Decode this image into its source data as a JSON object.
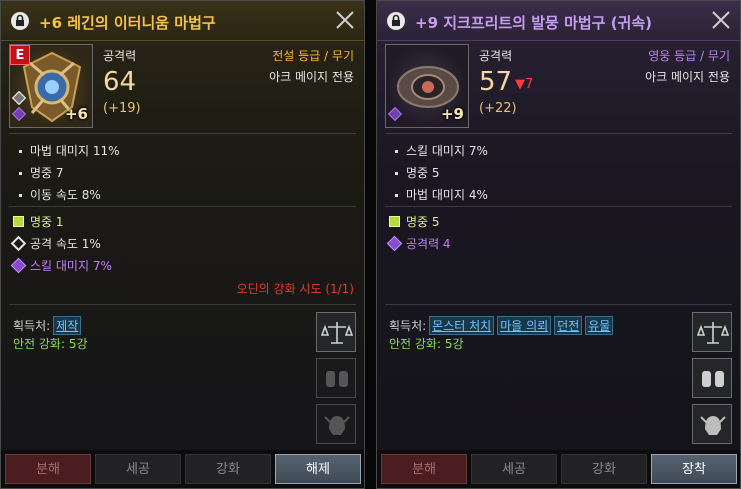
{
  "left": {
    "title": "+6 레긴의 이터니움 마법구",
    "badge": "E",
    "enhance": "+6",
    "attack_label": "공격력",
    "attack_value": "64",
    "attack_bonus": "(+19)",
    "grade": "전설 등급 / 무기",
    "class_only": "아크 메이지 전용",
    "stats": [
      "마법 대미지 11%",
      "명중 7",
      "이동 속도 8%"
    ],
    "subs": [
      {
        "text": "명중 1",
        "color": "#d8f47a"
      },
      {
        "text": "공격 속도 1%",
        "color": "#e4e4e4"
      },
      {
        "text": "스킬 대미지 7%",
        "color": "#c080f5"
      }
    ],
    "odin": "오딘의 강화 시도 (1/1)",
    "source_label": "획득처:",
    "sources": [
      "제작"
    ],
    "safe_enhance": "안전 강화: 5강",
    "buttons": [
      "분해",
      "세공",
      "강화",
      "해제"
    ]
  },
  "right": {
    "title": "+9 지크프리트의 발뭉 마법구 (귀속)",
    "enhance": "+9",
    "attack_label": "공격력",
    "attack_value": "57",
    "attack_delta": "▼7",
    "attack_bonus": "(+22)",
    "grade": "영웅 등급 / 무기",
    "class_only": "아크 메이지 전용",
    "stats": [
      "스킬 대미지 7%",
      "명중 5",
      "마법 대미지 4%"
    ],
    "subs": [
      {
        "text": "명중 5",
        "color": "#d8f47a"
      },
      {
        "text": "공격력 4",
        "color": "#c080f5"
      }
    ],
    "source_label": "획득처:",
    "sources": [
      "몬스터 처치",
      "마을 의뢰",
      "던전",
      "유물"
    ],
    "safe_enhance": "안전 강화: 5강",
    "buttons": [
      "분해",
      "세공",
      "강화",
      "장착"
    ]
  },
  "icons": [
    "lock-icon",
    "close-icon",
    "scale-icon",
    "compare-icon",
    "helmet-icon"
  ]
}
